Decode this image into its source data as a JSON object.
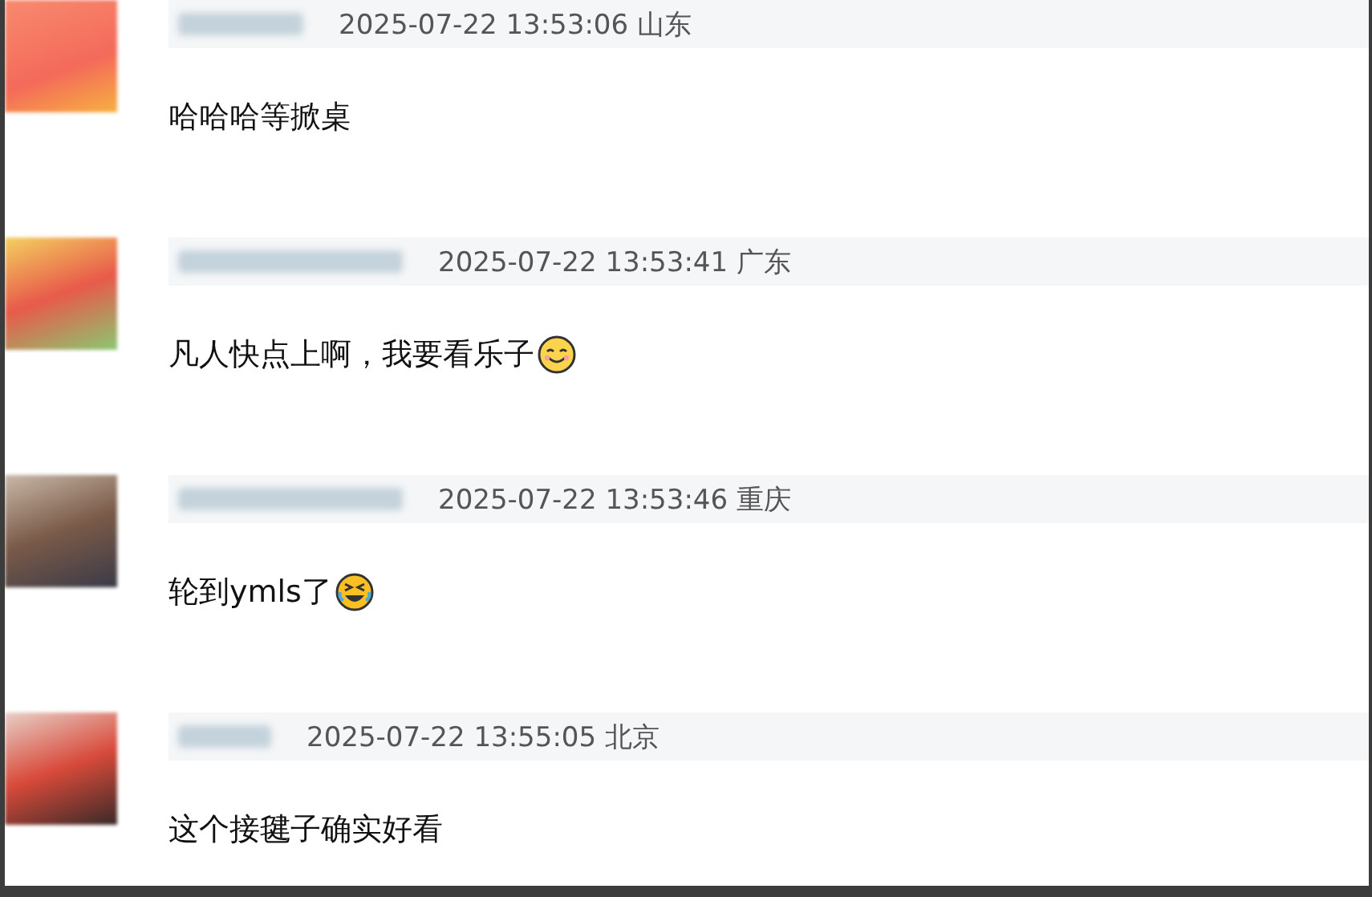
{
  "comments": [
    {
      "timestamp": "2025-07-22 13:53:06",
      "location": "山东",
      "text": "哈哈哈等掀桌",
      "kind": "plain"
    },
    {
      "timestamp": "2025-07-22 13:53:41",
      "location": "广东",
      "text": "凡人快点上啊，我要看乐子",
      "kind": "smiling"
    },
    {
      "timestamp": "2025-07-22 13:53:46",
      "location": "重庆",
      "text": "轮到ymls了",
      "kind": "laughing"
    },
    {
      "timestamp": "2025-07-22 13:55:05",
      "location": "北京",
      "text": "这个接毽子确实好看",
      "kind": "plain"
    }
  ]
}
